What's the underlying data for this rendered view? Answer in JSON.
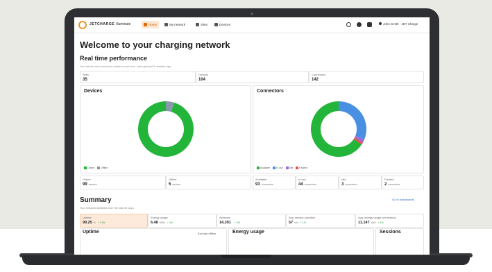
{
  "nav": {
    "brand": "JETCHARGE",
    "brand_suffix": "illuminate",
    "items": [
      {
        "label": "Home",
        "icon": "home-icon",
        "active": true
      },
      {
        "label": "My network",
        "icon": "network-icon",
        "active": false
      },
      {
        "label": "Sites",
        "icon": "sites-icon",
        "active": false
      },
      {
        "label": "Devices",
        "icon": "devices-icon",
        "active": false
      }
    ],
    "user": "John Smith - JET Charge"
  },
  "page": {
    "title": "Welcome to your charging network",
    "section_title": "Real time performance",
    "section_sub": "Your device and connector status in real time. Last updated 3 minutes ago."
  },
  "top_stats": [
    {
      "label": "Sites",
      "value": "35"
    },
    {
      "label": "Devices",
      "value": "104"
    },
    {
      "label": "Connectors",
      "value": "142"
    }
  ],
  "colors": {
    "green": "#22b53a",
    "blue": "#4a90e2",
    "grey": "#8a98ad",
    "red": "#e0534a",
    "purple": "#9a6cd6",
    "accent": "#e8952c"
  },
  "devices_chart": {
    "title": "Devices",
    "legend": [
      "Online",
      "Offline"
    ]
  },
  "connectors_chart": {
    "title": "Connectors",
    "legend": [
      "Available",
      "In use",
      "Idle",
      "Faulted"
    ]
  },
  "chart_data": [
    {
      "type": "pie",
      "title": "Devices",
      "categories": [
        "Online",
        "Offline"
      ],
      "values": [
        99,
        5
      ]
    },
    {
      "type": "pie",
      "title": "Connectors",
      "categories": [
        "Available",
        "In use",
        "Idle",
        "Faulted"
      ],
      "values": [
        93,
        44,
        3,
        2
      ]
    }
  ],
  "device_stats": [
    {
      "label": "Online",
      "value": "99",
      "unit": "devices"
    },
    {
      "label": "Offline",
      "value": "5",
      "unit": "devices"
    }
  ],
  "connector_stats": [
    {
      "label": "Available",
      "value": "93",
      "unit": "connectors"
    },
    {
      "label": "In use",
      "value": "44",
      "unit": "connectors"
    },
    {
      "label": "Idle",
      "value": "3",
      "unit": "connectors"
    },
    {
      "label": "Faulted",
      "value": "2",
      "unit": "connectors"
    }
  ],
  "summary": {
    "title": "Summary",
    "sub": "Your network statistics over the last 30 days.",
    "link": "Go to dashboards",
    "cards": [
      {
        "label": "Uptime",
        "value": "99.25",
        "unit": "%",
        "delta": "+ 0.5%"
      },
      {
        "label": "Energy usage",
        "value": "6.48",
        "unit": "MWh",
        "delta": "+ 3%"
      },
      {
        "label": "Sessions",
        "value": "14,391",
        "unit": "",
        "delta": "+ 4%"
      },
      {
        "label": "Avg. session duration",
        "value": "57",
        "unit": "min",
        "delta": "+ 1%"
      },
      {
        "label": "Avg. energy usage per session",
        "value": "11.147",
        "unit": "kWh",
        "delta": "+ 4%"
      }
    ]
  },
  "bottom": {
    "uptime": "Uptime",
    "exclude": "Exclude offline",
    "energy": "Energy usage",
    "sessions": "Sessions"
  }
}
